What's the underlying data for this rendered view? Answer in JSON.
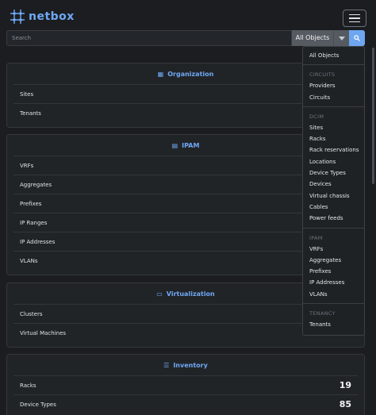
{
  "app": {
    "name": "netbox"
  },
  "search": {
    "placeholder": "Search",
    "scope": "All Objects"
  },
  "cards": {
    "organization": {
      "title": "Organization",
      "rows": [
        "Sites",
        "Tenants"
      ]
    },
    "ipam": {
      "title": "IPAM",
      "rows": [
        "VRFs",
        "Aggregates",
        "Prefixes",
        "IP Ranges",
        "IP Addresses",
        "VLANs"
      ]
    },
    "virtualization": {
      "title": "Virtualization",
      "rows": [
        "Clusters",
        "Virtual Machines"
      ]
    },
    "inventory": {
      "title": "Inventory",
      "rows": [
        {
          "label": "Racks",
          "count": "19"
        },
        {
          "label": "Device Types",
          "count": "85"
        }
      ]
    }
  },
  "dropdown": {
    "all": "All Objects",
    "circuits_head": "CIRCUITS",
    "circuits": [
      "Providers",
      "Circuits"
    ],
    "dcim_head": "DCIM",
    "dcim": [
      "Sites",
      "Racks",
      "Rack reservations",
      "Locations",
      "Device Types",
      "Devices",
      "Virtual chassis",
      "Cables",
      "Power feeds"
    ],
    "ipam_head": "IPAM",
    "ipam": [
      "VRFs",
      "Aggregates",
      "Prefixes",
      "IP Addresses",
      "VLANs"
    ],
    "tenancy_head": "TENANCY",
    "tenancy": [
      "Tenants"
    ]
  },
  "colors": {
    "accent": "#6fa8f5",
    "background": "#1b1d20",
    "card": "#212427"
  },
  "icons": {
    "organization": "building-icon",
    "ipam": "ip-network-icon",
    "virtualization": "monitor-icon",
    "inventory": "list-icon"
  }
}
